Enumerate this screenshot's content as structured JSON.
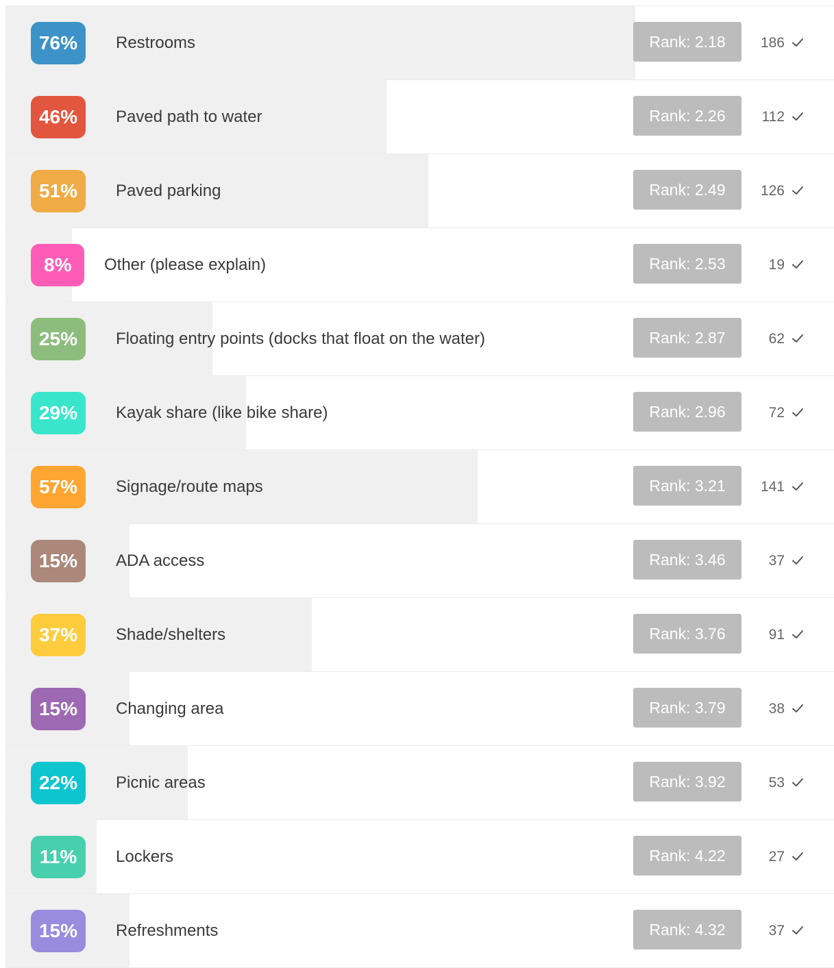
{
  "chart_data": {
    "type": "bar",
    "categories": [
      "Restrooms",
      "Paved path to water",
      "Paved parking",
      "Other (please explain)",
      "Floating entry points (docks that float on the water)",
      "Kayak share (like bike share)",
      "Signage/route maps",
      "ADA access",
      "Shade/shelters",
      "Changing area",
      "Picnic areas",
      "Lockers",
      "Refreshments"
    ],
    "values": [
      76,
      46,
      51,
      8,
      25,
      29,
      57,
      15,
      37,
      15,
      22,
      11,
      15
    ],
    "percent_labels": [
      "76%",
      "46%",
      "51%",
      "8%",
      "25%",
      "29%",
      "57%",
      "15%",
      "37%",
      "15%",
      "22%",
      "11%",
      "15%"
    ],
    "ranks": [
      "Rank: 2.18",
      "Rank: 2.26",
      "Rank: 2.49",
      "Rank: 2.53",
      "Rank: 2.87",
      "Rank: 2.96",
      "Rank: 3.21",
      "Rank: 3.46",
      "Rank: 3.76",
      "Rank: 3.79",
      "Rank: 3.92",
      "Rank: 4.22",
      "Rank: 4.32"
    ],
    "counts": [
      "186",
      "112",
      "126",
      "19",
      "62",
      "72",
      "141",
      "37",
      "91",
      "38",
      "53",
      "27",
      "37"
    ],
    "colors": [
      "#3d93c7",
      "#e2563f",
      "#f0ab46",
      "#ff5cb8",
      "#8cbd7c",
      "#39e6cc",
      "#ffa531",
      "#ab887a",
      "#ffcc3e",
      "#9d69b2",
      "#0ec5cf",
      "#48cfae",
      "#998bde"
    ],
    "fill_color": "#f0f0f0",
    "rank_color": "#bcbcbc"
  }
}
